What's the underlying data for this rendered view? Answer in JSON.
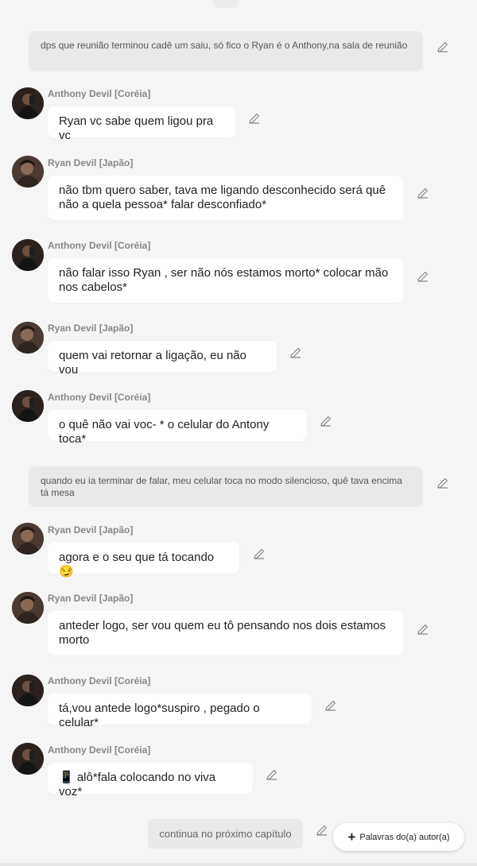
{
  "narrations": [
    "dps que reunião terminou cadê um saiu, só fico o Ryan é o Anthony,na sala de reunião",
    "quando eu ia terminar de falar, meu celular toca no modo silencioso, quê tava encima tá mesa"
  ],
  "messages": [
    {
      "author": "Anthony Devil [Coréia]",
      "text": "Ryan vc sabe quem ligou pra vc"
    },
    {
      "author": "Ryan Devil [Japão]",
      "text": "não tbm quero saber, tava me ligando desconhecido será quê não a quela pessoa* falar desconfiado*"
    },
    {
      "author": "Anthony Devil [Coréia]",
      "text": "não falar isso Ryan , ser não nós estamos morto* colocar mão nos cabelos*"
    },
    {
      "author": "Ryan Devil [Japão]",
      "text": "quem vai retornar a ligação, eu não vou"
    },
    {
      "author": "Anthony Devil [Coréia]",
      "text": "o quê não vai voc- * o celular do Antony toca*"
    },
    {
      "author": "Ryan Devil [Japão]",
      "text": "agora e o seu que tá tocando 😏"
    },
    {
      "author": "Ryan Devil [Japão]",
      "text": "anteder logo, ser vou quem eu tô pensando nos dois estamos morto"
    },
    {
      "author": "Anthony Devil [Coréia]",
      "text": "tá,vou antede logo*suspiro , pegado o celular*"
    },
    {
      "author": "Anthony Devil [Coréia]",
      "text": "📱 alô*fala colocando no viva voz*"
    }
  ],
  "continuation": "continua no próximo capítulo",
  "author_words_button": "Palavras do(a) autor(a)",
  "icons": {
    "edit": "pencil-icon",
    "add": "plus-icon",
    "avatar_anthony": "avatar-anthony",
    "avatar_ryan": "avatar-ryan"
  },
  "colors": {
    "background": "#f5f5f5",
    "bubble": "#ffffff",
    "narration": "#e9e9e9",
    "name": "#888888"
  }
}
